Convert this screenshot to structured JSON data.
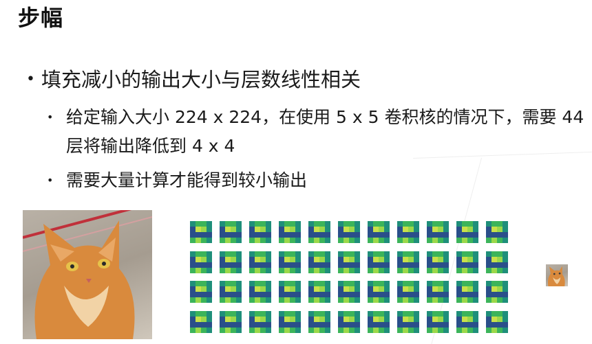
{
  "slide": {
    "title": "步幅",
    "bullet_1": "填充减小的输出大小与层数线性相关",
    "bullet_1_dot": "•",
    "sub_bullet_dot": "•",
    "sub_bullets": [
      "给定输入大小 224 x 224，在使用 5 x 5 卷积核的情况下，需要 44 层将输出降低到 4 x 4",
      "需要大量计算才能得到较小输出"
    ]
  },
  "illustration": {
    "input_image": "cat-photo",
    "feature_map_rows": 4,
    "feature_map_cols": 11,
    "output_image": "cat-photo-small",
    "colors": {
      "fmap_dark": "#2a4f8a",
      "fmap_mid": "#1f8f7a",
      "fmap_green": "#3cb45a",
      "fmap_light": "#9bd84a",
      "fmap_yellow": "#c8e04a",
      "cat_orange": "#d98a3d",
      "cat_light": "#f2d3a6",
      "background_gray": "#b3aa9e",
      "red_stripe": "#c0303a"
    }
  }
}
